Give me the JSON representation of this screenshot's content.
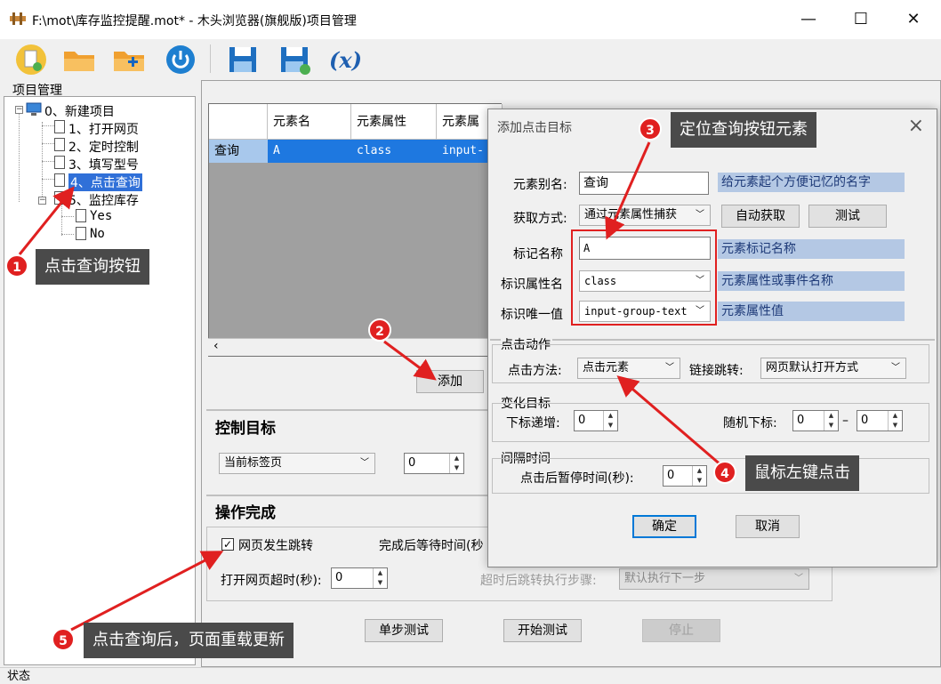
{
  "window": {
    "title": "F:\\mot\\库存监控提醒.mot* - 木头浏览器(旗舰版)项目管理",
    "min": "—",
    "max": "☐",
    "close": "✕"
  },
  "toolbar": [
    "new-project-icon",
    "open-folder-icon",
    "add-folder-icon",
    "power-icon",
    "save-icon",
    "save-as-icon",
    "variable-icon"
  ],
  "left_panel": {
    "title": "项目管理",
    "tree": [
      {
        "label": "0、新建项目"
      },
      {
        "label": "1、打开网页"
      },
      {
        "label": "2、定时控制"
      },
      {
        "label": "3、填写型号"
      },
      {
        "label": "4、点击查询"
      },
      {
        "label": "5、监控库存"
      },
      {
        "label": "Yes"
      },
      {
        "label": "No"
      }
    ]
  },
  "grid": {
    "headers": [
      "",
      "元素名",
      "元素属性",
      "元素属"
    ],
    "row": [
      "查询",
      "A",
      "class",
      "input-gro"
    ]
  },
  "buttons": {
    "add": "添加",
    "step_test": "单步测试",
    "start_test": "开始测试",
    "stop": "停止"
  },
  "control_target": {
    "title": "控制目标",
    "tab_select": "当前标签页",
    "spin_value": "0"
  },
  "operation_done": {
    "title": "操作完成",
    "page_jump_label": "网页发生跳转",
    "page_jump_checked": "✓",
    "wait_label": "完成后等待时间(秒",
    "timeout_label": "打开网页超时(秒):",
    "timeout_value": "0",
    "after_timeout_label": "超时后跳转执行步骤:",
    "after_timeout_value": "默认执行下一步"
  },
  "dialog": {
    "title": "添加点击目标",
    "alias_label": "元素别名:",
    "alias_value": "查询",
    "alias_hint": "给元素起个方便记忆的名字",
    "method_label": "获取方式:",
    "method_value": "通过元素属性捕获",
    "auto_get": "自动获取",
    "test": "测试",
    "tag_label": "标记名称",
    "tag_value": "A",
    "tag_hint": "元素标记名称",
    "attr_label": "标识属性名",
    "attr_value": "class",
    "attr_hint": "元素属性或事件名称",
    "unique_label": "标识唯一值",
    "unique_value": "input-group-text",
    "unique_hint": "元素属性值",
    "click_action_title": "点击动作",
    "click_method_label": "点击方法:",
    "click_method_value": "点击元素",
    "link_jump_label": "链接跳转:",
    "link_jump_value": "网页默认打开方式",
    "change_target_title": "变化目标",
    "index_inc_label": "下标递增:",
    "index_inc_value": "0",
    "random_index_label": "随机下标:",
    "random_from": "0",
    "random_dash": "–",
    "random_to": "0",
    "interval_title": "间隔时间",
    "pause_label": "点击后暂停时间(秒):",
    "pause_value": "0",
    "ok": "确定",
    "cancel": "取消"
  },
  "annotations": [
    {
      "num": "1",
      "text": "点击查询按钮"
    },
    {
      "num": "2",
      "text": ""
    },
    {
      "num": "3",
      "text": "定位查询按钮元素"
    },
    {
      "num": "4",
      "text": "鼠标左键点击"
    },
    {
      "num": "5",
      "text": "点击查询后，页面重载更新"
    }
  ],
  "status": "状态",
  "colors": {
    "annotation_red": "#e02020",
    "selection_blue": "#3070d8",
    "hint_bg": "#b4c8e4"
  }
}
